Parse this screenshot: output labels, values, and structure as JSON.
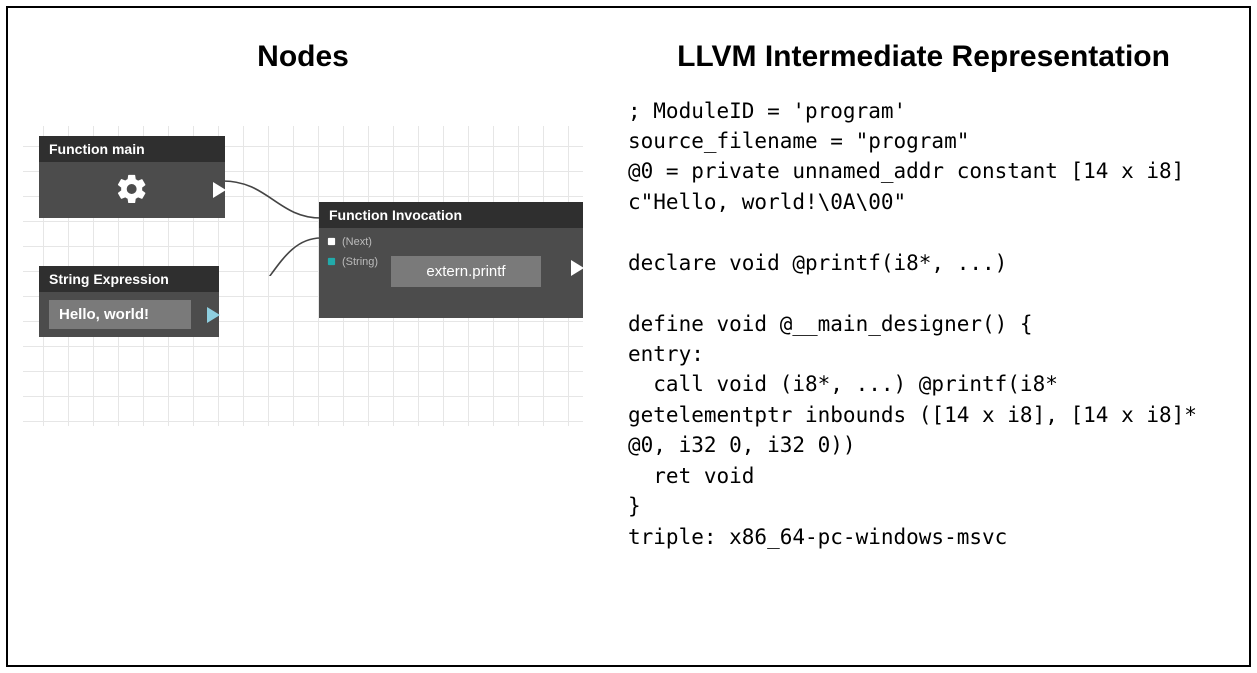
{
  "left": {
    "title": "Nodes",
    "nodes": {
      "main": {
        "title": "Function main"
      },
      "string": {
        "title": "String Expression",
        "value": "Hello, world!"
      },
      "invoke": {
        "title": "Function Invocation",
        "port_next": "(Next)",
        "port_string": "(String)",
        "value": "extern.printf"
      }
    }
  },
  "right": {
    "title": "LLVM Intermediate Representation",
    "code": "; ModuleID = 'program'\nsource_filename = \"program\"\n@0 = private unnamed_addr constant [14 x i8]\nc\"Hello, world!\\0A\\00\"\n\ndeclare void @printf(i8*, ...)\n\ndefine void @__main_designer() {\nentry:\n  call void (i8*, ...) @printf(i8*\ngetelementptr inbounds ([14 x i8], [14 x i8]*\n@0, i32 0, i32 0))\n  ret void\n}\ntriple: x86_64-pc-windows-msvc"
  }
}
